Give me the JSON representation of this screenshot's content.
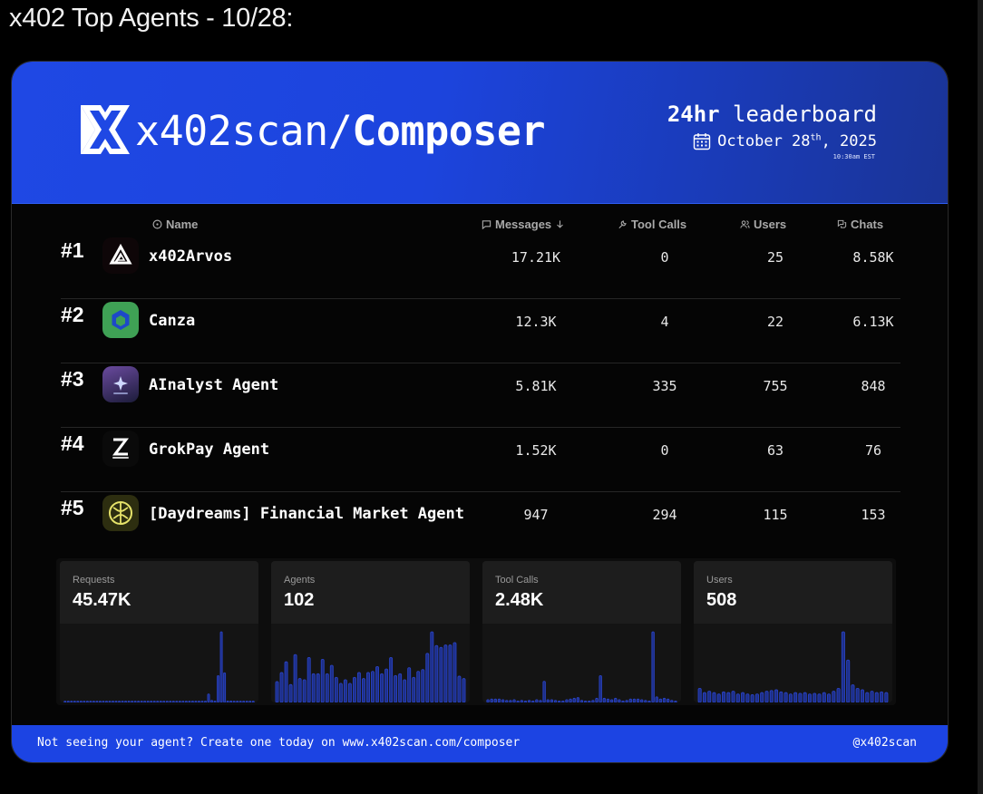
{
  "post": {
    "title": "x402 Top Agents - 10/28:"
  },
  "banner": {
    "brand_prefix": "x402scan/",
    "brand_suffix": "Composer",
    "leaderboard_bold": "24hr",
    "leaderboard_rest": " leaderboard",
    "date_main": "October 28",
    "date_sup": "th",
    "date_year": ", 2025",
    "time": "10:30am EST",
    "logo_icon": "x402-logo-icon",
    "calendar_icon": "calendar-icon"
  },
  "table": {
    "headers": {
      "name": "Name",
      "messages": "Messages",
      "tool_calls": "Tool Calls",
      "users": "Users",
      "chats": "Chats"
    },
    "rows": [
      {
        "rank": "#1",
        "name": "x402Arvos",
        "messages": "17.21K",
        "tool_calls": "0",
        "users": "25",
        "chats": "8.58K"
      },
      {
        "rank": "#2",
        "name": "Canza",
        "messages": "12.3K",
        "tool_calls": "4",
        "users": "22",
        "chats": "6.13K"
      },
      {
        "rank": "#3",
        "name": "AInalyst Agent",
        "messages": "5.81K",
        "tool_calls": "335",
        "users": "755",
        "chats": "848"
      },
      {
        "rank": "#4",
        "name": "GrokPay Agent",
        "messages": "1.52K",
        "tool_calls": "0",
        "users": "63",
        "chats": "76"
      },
      {
        "rank": "#5",
        "name": "[Daydreams] Financial Market Agent",
        "messages": "947",
        "tool_calls": "294",
        "users": "115",
        "chats": "153"
      }
    ]
  },
  "stats": [
    {
      "label": "Requests",
      "value": "45.47K",
      "bars": [
        1,
        1,
        1,
        1,
        1,
        1,
        1,
        1,
        1,
        1,
        1,
        1,
        1,
        1,
        1,
        1,
        1,
        1,
        1,
        1,
        1,
        1,
        1,
        1,
        1,
        1,
        1,
        1,
        1,
        1,
        1,
        1,
        1,
        1,
        1,
        1,
        1,
        1,
        1,
        1,
        1,
        1,
        1,
        1,
        1,
        12,
        3,
        2,
        38,
        100,
        42,
        2,
        2,
        1,
        1,
        1,
        1,
        1,
        1,
        1
      ]
    },
    {
      "label": "Agents",
      "value": "102",
      "bars": [
        35,
        50,
        68,
        30,
        80,
        40,
        38,
        75,
        48,
        48,
        72,
        48,
        62,
        42,
        32,
        38,
        32,
        42,
        50,
        40,
        50,
        52,
        60,
        48,
        56,
        75,
        45,
        48,
        38,
        58,
        42,
        52,
        55,
        82,
        118,
        95,
        92,
        96,
        96,
        100,
        44,
        40
      ]
    },
    {
      "label": "Tool Calls",
      "value": "2.48K",
      "bars": [
        4,
        5,
        5,
        5,
        4,
        3,
        3,
        4,
        2,
        3,
        2,
        3,
        2,
        4,
        3,
        30,
        4,
        4,
        3,
        2,
        2,
        4,
        5,
        6,
        7,
        3,
        2,
        2,
        3,
        6,
        38,
        6,
        5,
        4,
        6,
        4,
        2,
        3,
        5,
        5,
        5,
        4,
        3,
        2,
        100,
        8,
        5,
        6,
        5,
        3,
        2
      ]
    },
    {
      "label": "Users",
      "value": "508",
      "bars": [
        20,
        14,
        16,
        14,
        12,
        15,
        14,
        16,
        12,
        14,
        12,
        11,
        12,
        14,
        16,
        17,
        18,
        15,
        14,
        12,
        14,
        13,
        14,
        12,
        13,
        12,
        14,
        12,
        16,
        20,
        100,
        60,
        25,
        20,
        18,
        14,
        16,
        14,
        15,
        14
      ]
    }
  ],
  "footer": {
    "left": "Not seeing your agent? Create one today on www.x402scan.com/composer",
    "right": "@x402scan"
  },
  "colors": {
    "banner_blue": "#1f48e4",
    "footer_blue": "#1c44e3",
    "bar_blue": "#2a44c8"
  }
}
